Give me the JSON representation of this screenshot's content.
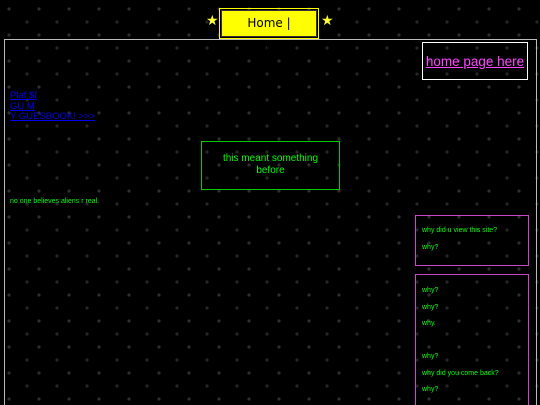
{
  "nav": {
    "label": "Home | Directory",
    "star_left": "★",
    "star_right": "★"
  },
  "home_link": "home page here",
  "left_links": [
    "Plaf ${",
    "GU M",
    "Y GUESBOOK! >>>"
  ],
  "meant_box": {
    "line1": "this meant something",
    "line2": "before"
  },
  "aliens_text": "no one believes aliens r real.",
  "box1": [
    "why did u view this site?",
    "why?"
  ],
  "box2": [
    "why?",
    "why?",
    "why.",
    "",
    "why?",
    "why did you come back?",
    "why?"
  ],
  "colors": {
    "background": "#000000",
    "nav_bg": "#ffff00",
    "star": "#ffff33",
    "link": "#0000ee",
    "home_link": "#ff44ff",
    "green_text": "#00ff00",
    "magenta_border": "#cc44cc"
  }
}
